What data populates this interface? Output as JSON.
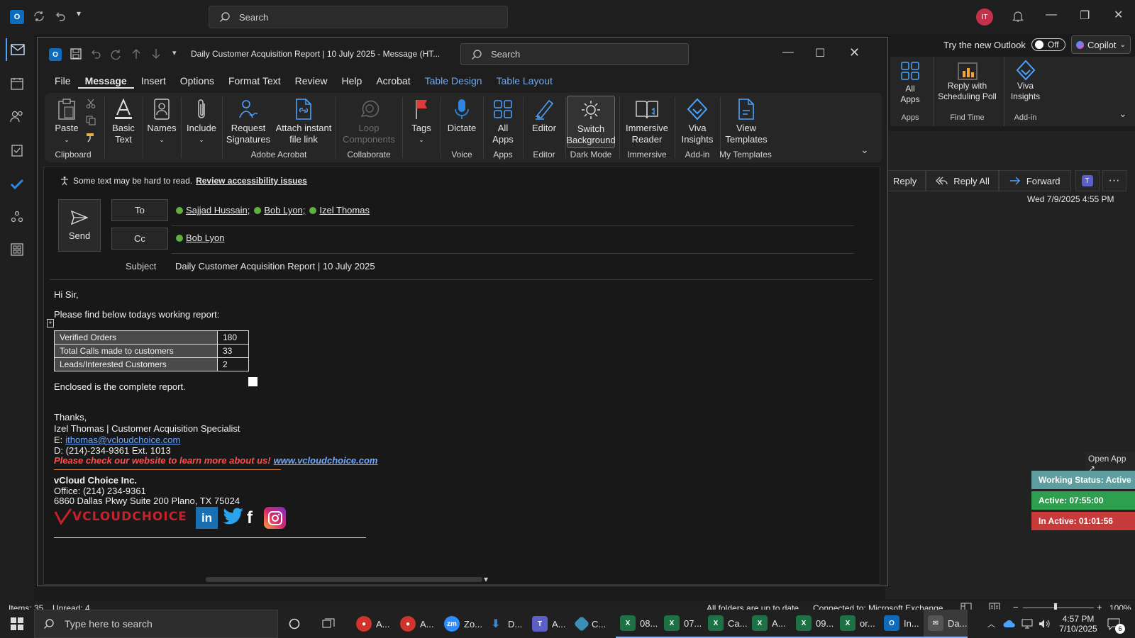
{
  "outer": {
    "search_placeholder": "Search",
    "avatar_initials": "IT",
    "try_new_outlook": "Try the new Outlook",
    "toggle_state": "Off",
    "copilot_label": "Copilot"
  },
  "right_ribbon": {
    "groups": [
      {
        "label": "All Apps",
        "line2": "",
        "caption": "Apps"
      },
      {
        "label": "Reply with",
        "line2": "Scheduling Poll",
        "caption": "Find Time"
      },
      {
        "label": "Viva",
        "line2": "Insights",
        "caption": "Add-in"
      }
    ]
  },
  "reading_pane": {
    "reply": "Reply",
    "reply_all": "Reply All",
    "forward": "Forward",
    "timestamp": "Wed 7/9/2025 4:55 PM",
    "open_app": "Open App ↗",
    "status_working": "Working Status: Active",
    "status_active": "Active: 07:55:00",
    "status_inactive": "In Active: 01:01:56"
  },
  "compose": {
    "window_title": "Daily Customer Acquisition Report | 10 July 2025  -  Message (HT...",
    "search_placeholder": "Search",
    "menu_tabs": [
      "File",
      "Message",
      "Insert",
      "Options",
      "Format Text",
      "Review",
      "Help",
      "Acrobat",
      "Table Design",
      "Table Layout"
    ],
    "ribbon": {
      "paste": "Paste",
      "basic_text": "Basic Text",
      "names": "Names",
      "include": "Include",
      "clipboard": "Clipboard",
      "request_signatures_1": "Request",
      "request_signatures_2": "Signatures",
      "attach_instant_1": "Attach instant",
      "attach_instant_2": "file link",
      "adobe_acrobat": "Adobe Acrobat",
      "loop_1": "Loop",
      "loop_2": "Components",
      "collaborate": "Collaborate",
      "tags": "Tags",
      "dictate": "Dictate",
      "voice": "Voice",
      "all_apps_1": "All",
      "all_apps_2": "Apps",
      "apps": "Apps",
      "editor": "Editor",
      "editor_caption": "Editor",
      "switch_bg_1": "Switch",
      "switch_bg_2": "Background",
      "dark_mode": "Dark Mode",
      "immersive_1": "Immersive",
      "immersive_2": "Reader",
      "immersive_caption": "Immersive",
      "viva_1": "Viva",
      "viva_2": "Insights",
      "addin_caption": "Add-in",
      "view_templates_1": "View",
      "view_templates_2": "Templates",
      "my_templates": "My Templates"
    },
    "accessibility_text": "Some text may be hard to read.",
    "accessibility_link": "Review accessibility issues",
    "send_label": "Send",
    "to_label": "To",
    "cc_label": "Cc",
    "subject_label": "Subject",
    "subject_value": "Daily Customer Acquisition Report | 10 July 2025",
    "to_recipients": [
      "Sajjad Hussain;",
      "Bob Lyon;",
      "Izel Thomas"
    ],
    "cc_recipients": [
      "Bob Lyon"
    ]
  },
  "email": {
    "greeting": "Hi Sir,",
    "intro": "Please find below todays working report:",
    "table": [
      {
        "label": "Verified Orders",
        "value": "180"
      },
      {
        "label": "Total Calls made to customers",
        "value": "33"
      },
      {
        "label": "Leads/Interested Customers",
        "value": "2"
      }
    ],
    "enclosed": "Enclosed is the complete report.",
    "thanks": "Thanks,",
    "sig_name": "Izel Thomas | Customer Acquisition Specialist",
    "sig_email_prefix": "E:",
    "sig_email": "ithomas@vcloudchoice.com",
    "sig_phone": "D: (214)-234-9361 Ext. 1013",
    "sig_cta": "Please check our website to learn more about us!",
    "sig_website": "www.vcloudchoice.com",
    "company": "vCloud Choice Inc.",
    "office": "Office: (214) 234-9361",
    "address": "6860 Dallas Pkwy Suite 200 Plano, TX 75024",
    "logo_text": "VCLOUDCHOICE"
  },
  "status_bar": {
    "items": "Items: 35",
    "unread": "Unread: 4",
    "folders": "All folders are up to date.",
    "connected": "Connected to: Microsoft Exchange",
    "zoom": "100%"
  },
  "taskbar": {
    "search_placeholder": "Type here to search",
    "apps": [
      {
        "label": "A...",
        "color": "#d0342c",
        "icon": "chrome-icon"
      },
      {
        "label": "A...",
        "color": "#d0342c",
        "icon": "chrome-icon"
      },
      {
        "label": "Zo...",
        "color": "#2d8cff",
        "icon": "zoom-icon"
      },
      {
        "label": "D...",
        "color": "#3a86d8",
        "icon": "download-icon"
      },
      {
        "label": "A...",
        "color": "#5b5fc7",
        "icon": "teams-icon"
      },
      {
        "label": "C...",
        "color": "#3a8fb7",
        "icon": "app-icon"
      },
      {
        "label": "08...",
        "color": "#1e7145",
        "icon": "excel-icon"
      },
      {
        "label": "07...",
        "color": "#1e7145",
        "icon": "excel-icon"
      },
      {
        "label": "Ca...",
        "color": "#1e7145",
        "icon": "excel-icon"
      },
      {
        "label": "A...",
        "color": "#1e7145",
        "icon": "excel-icon"
      },
      {
        "label": "09...",
        "color": "#1e7145",
        "icon": "excel-icon"
      },
      {
        "label": "or...",
        "color": "#1e7145",
        "icon": "excel-icon"
      },
      {
        "label": "In...",
        "color": "#0f6cbd",
        "icon": "outlook-icon"
      },
      {
        "label": "Da...",
        "color": "#555555",
        "icon": "message-icon"
      }
    ],
    "time": "4:57 PM",
    "date": "7/10/2025",
    "notif_count": "6"
  }
}
